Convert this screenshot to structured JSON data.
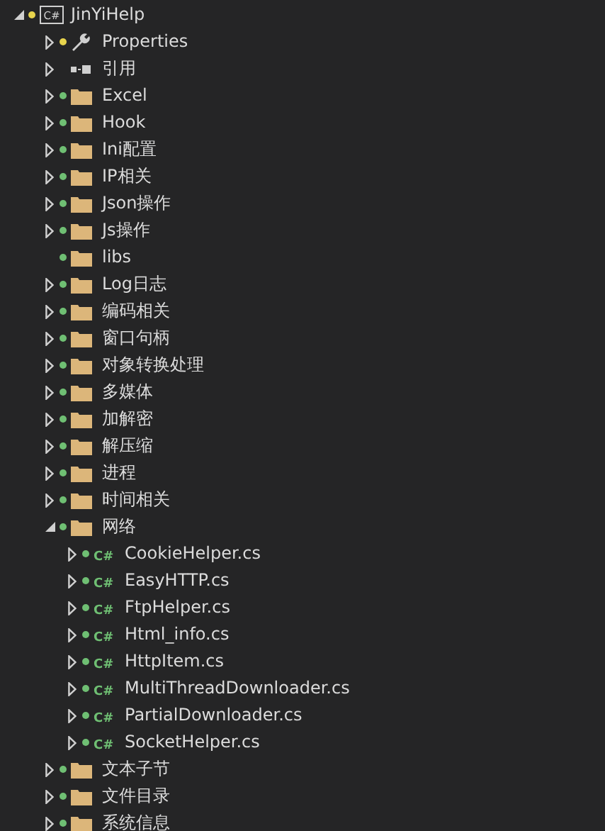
{
  "tree": [
    {
      "label": "JinYiHelp",
      "kind": "project",
      "icon_text": "C#",
      "expanded": true,
      "color": "#e8d44d",
      "children": [
        {
          "label": "Properties",
          "kind": "properties",
          "expanded": false,
          "color": "#e8d44d"
        },
        {
          "label": "引用",
          "kind": "references",
          "expanded": false
        },
        {
          "label": "Excel",
          "kind": "folder",
          "expanded": false,
          "color": "#6fbf73"
        },
        {
          "label": "Hook",
          "kind": "folder",
          "expanded": false,
          "color": "#6fbf73"
        },
        {
          "label": "Ini配置",
          "kind": "folder",
          "expanded": false,
          "color": "#6fbf73"
        },
        {
          "label": "IP相关",
          "kind": "folder",
          "expanded": false,
          "color": "#6fbf73"
        },
        {
          "label": "Json操作",
          "kind": "folder",
          "expanded": false,
          "color": "#6fbf73"
        },
        {
          "label": "Js操作",
          "kind": "folder",
          "expanded": false,
          "color": "#6fbf73"
        },
        {
          "label": "libs",
          "kind": "folder",
          "color": "#6fbf73"
        },
        {
          "label": "Log日志",
          "kind": "folder",
          "expanded": false,
          "color": "#6fbf73"
        },
        {
          "label": "编码相关",
          "kind": "folder",
          "expanded": false,
          "color": "#6fbf73"
        },
        {
          "label": "窗口句柄",
          "kind": "folder",
          "expanded": false,
          "color": "#6fbf73"
        },
        {
          "label": "对象转换处理",
          "kind": "folder",
          "expanded": false,
          "color": "#6fbf73"
        },
        {
          "label": "多媒体",
          "kind": "folder",
          "expanded": false,
          "color": "#6fbf73"
        },
        {
          "label": "加解密",
          "kind": "folder",
          "expanded": false,
          "color": "#6fbf73"
        },
        {
          "label": "解压缩",
          "kind": "folder",
          "expanded": false,
          "color": "#6fbf73"
        },
        {
          "label": "进程",
          "kind": "folder",
          "expanded": false,
          "color": "#6fbf73"
        },
        {
          "label": "时间相关",
          "kind": "folder",
          "expanded": false,
          "color": "#6fbf73"
        },
        {
          "label": "网络",
          "kind": "folder",
          "expanded": true,
          "color": "#6fbf73",
          "children": [
            {
              "label": "CookieHelper.cs",
              "kind": "file",
              "icon_text": "C#",
              "expanded": false,
              "color": "#6fbf73"
            },
            {
              "label": "EasyHTTP.cs",
              "kind": "file",
              "icon_text": "C#",
              "expanded": false,
              "color": "#6fbf73"
            },
            {
              "label": "FtpHelper.cs",
              "kind": "file",
              "icon_text": "C#",
              "expanded": false,
              "color": "#6fbf73"
            },
            {
              "label": "Html_info.cs",
              "kind": "file",
              "icon_text": "C#",
              "expanded": false,
              "color": "#6fbf73"
            },
            {
              "label": "HttpItem.cs",
              "kind": "file",
              "icon_text": "C#",
              "expanded": false,
              "color": "#6fbf73"
            },
            {
              "label": "MultiThreadDownloader.cs",
              "kind": "file",
              "icon_text": "C#",
              "expanded": false,
              "color": "#6fbf73"
            },
            {
              "label": "PartialDownloader.cs",
              "kind": "file",
              "icon_text": "C#",
              "expanded": false,
              "color": "#6fbf73"
            },
            {
              "label": "SocketHelper.cs",
              "kind": "file",
              "icon_text": "C#",
              "expanded": false,
              "color": "#6fbf73"
            }
          ]
        },
        {
          "label": "文本子节",
          "kind": "folder",
          "expanded": false,
          "color": "#6fbf73"
        },
        {
          "label": "文件目录",
          "kind": "folder",
          "expanded": false,
          "color": "#6fbf73"
        },
        {
          "label": "系统信息",
          "kind": "folder",
          "expanded": false,
          "color": "#6fbf73"
        }
      ]
    }
  ]
}
